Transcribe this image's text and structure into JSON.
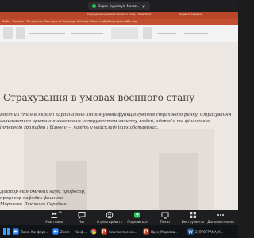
{
  "share_bar": {
    "presenter": "Экран (Lyudmyla Moroz..."
  },
  "powerpoint": {
    "titlebar_text": "Страхування в умовах воєнного стану - PowerPoint",
    "titlebar_right": "Людмила Серебна",
    "tabs": [
      "Файл",
      "Основне",
      "Вставлення",
      "Конструктор",
      "Переходи",
      "Анімація",
      "Показ слайдів",
      "Рецензування",
      "Вигляд"
    ]
  },
  "slide": {
    "title": "Страхування в умовах воєнного стану",
    "body_lines": [
      "Воєнний стан в Україні кардинально змінив умови функціонування страхового ринку. Страхування",
      "залишається критично важливим інструментом захисту людей, здоров'я та фінансових",
      "інтересів громадян і бізнесу — навіть у найскладніших обставинах."
    ],
    "author_lines": [
      "Доктор економічних наук, професор,",
      "професор кафедри фінансів",
      "Морозова Людмила Сергіївна"
    ]
  },
  "toolbar": {
    "items": [
      {
        "label": "Участники",
        "icon": "participants-icon"
      },
      {
        "label": "Чат",
        "icon": "chat-icon"
      },
      {
        "label": "Отреагировать",
        "icon": "react-icon"
      },
      {
        "label": "Поделиться",
        "icon": "share-screen-icon"
      },
      {
        "label": "Показ",
        "icon": "show-icon"
      },
      {
        "label": "Инструменты",
        "icon": "tools-icon"
      },
      {
        "label": "Дополнительно",
        "icon": "more-icon"
      }
    ],
    "participant_count": "88"
  },
  "taskbar": {
    "items": [
      {
        "label": "Zoom Конфере...",
        "icon": "zoom-icon",
        "color": "#2d8cff"
      },
      {
        "label": "Zoom — Конф...",
        "icon": "zoom-icon",
        "color": "#2d8cff"
      },
      {
        "label": "",
        "icon": "chrome-icon",
        "color": "#e8453c"
      },
      {
        "label": "Ссылка презен...",
        "icon": "powerpoint-icon",
        "color": "#d24726"
      },
      {
        "label": "Прес_Морозов...",
        "icon": "powerpoint-icon",
        "color": "#d24726"
      },
      {
        "label": "2_ПРОГРАМА_К...",
        "icon": "word-icon",
        "color": "#2b579a"
      }
    ]
  },
  "colors": {
    "ppt_accent": "#c2502f",
    "slide_bg": "#ece7e2",
    "zoom_bar": "#1e1e20",
    "taskbar": "#101418"
  }
}
